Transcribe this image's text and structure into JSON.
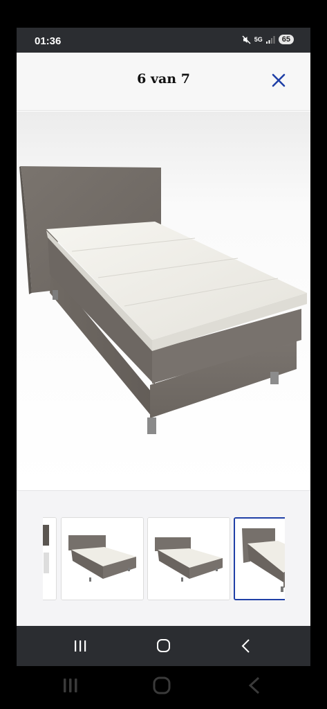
{
  "status_bar": {
    "time": "01:36",
    "network": "5G",
    "battery": "65",
    "icons": [
      "mute-icon",
      "signal-5g-icon",
      "signal-bars-icon",
      "battery-icon"
    ]
  },
  "viewer": {
    "title": "6 van 7",
    "close_icon": "close-icon",
    "accent_color": "#1f3fa6"
  },
  "main_image": {
    "subject": "boxspring-bed-grey-with-mattress-topper"
  },
  "thumbnails": {
    "active_index": 3,
    "items": [
      {
        "name": "thumbnail-partial"
      },
      {
        "name": "thumbnail-bed-front"
      },
      {
        "name": "thumbnail-bed-side"
      },
      {
        "name": "thumbnail-bed-angle"
      }
    ]
  },
  "app_nav": {
    "icons": [
      "recent-apps-icon",
      "home-icon",
      "back-icon"
    ]
  },
  "system_nav": {
    "icons": [
      "recent-apps-icon",
      "home-icon",
      "back-icon"
    ]
  }
}
